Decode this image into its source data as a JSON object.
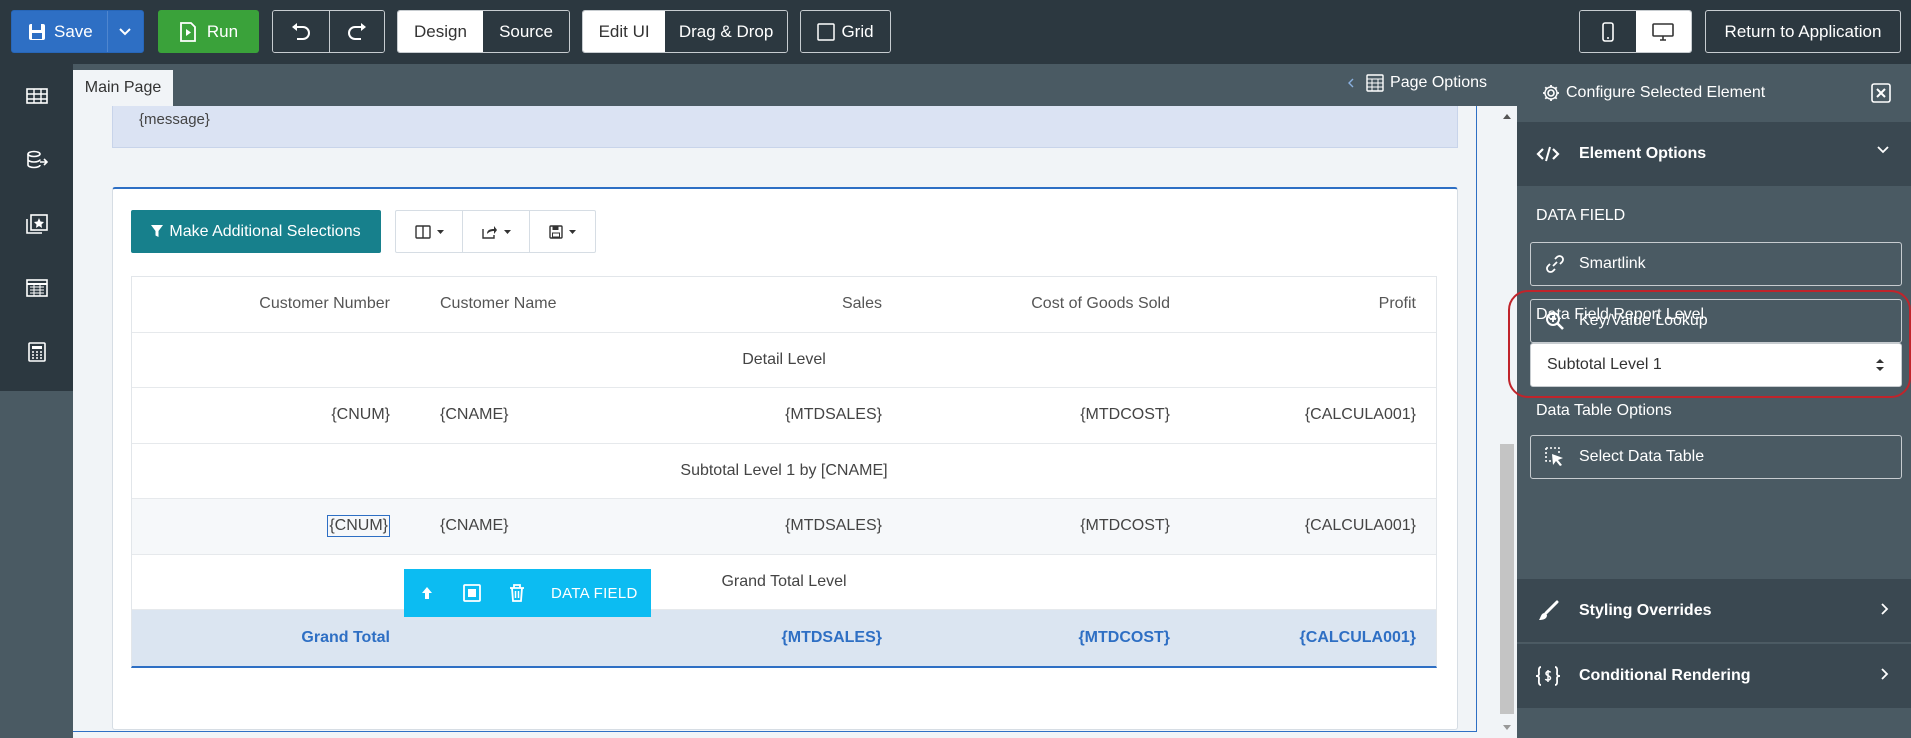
{
  "toolbar": {
    "save_label": "Save",
    "run_label": "Run",
    "design_label": "Design",
    "source_label": "Source",
    "edit_ui_label": "Edit UI",
    "drag_drop_label": "Drag & Drop",
    "grid_label": "Grid",
    "return_label": "Return to Application"
  },
  "tabs": {
    "main_page": "Main Page",
    "page_options": "Page Options"
  },
  "canvas": {
    "message": "{message}",
    "make_selections_label": "Make Additional Selections"
  },
  "table": {
    "headers": [
      "Customer Number",
      "Customer Name",
      "Sales",
      "Cost of Goods Sold",
      "Profit"
    ],
    "detail_level": "Detail Level",
    "detail_row": [
      "{CNUM}",
      "{CNAME}",
      "{MTDSALES}",
      "{MTDCOST}",
      "{CALCULA001}"
    ],
    "subtotal_level": "Subtotal Level 1 by [CNAME]",
    "subtotal_row": [
      "{CNUM}",
      "{CNAME}",
      "{MTDSALES}",
      "{MTDCOST}",
      "{CALCULA001}"
    ],
    "grand_total_level": "Grand Total Level",
    "grand_row": [
      "Grand Total",
      "",
      "{MTDSALES}",
      "{MTDCOST}",
      "{CALCULA001}"
    ]
  },
  "data_field_toolbar": {
    "label": "DATA FIELD"
  },
  "panel": {
    "title": "Configure Selected Element",
    "element_options": "Element Options",
    "data_field_heading": "DATA FIELD",
    "smartlink_label": "Smartlink",
    "kv_lookup_label": "Key/Value Lookup",
    "report_level_label": "Data Field Report Level",
    "report_level_value": "Subtotal Level 1",
    "data_table_options_label": "Data Table Options",
    "select_data_table_label": "Select Data Table",
    "styling_overrides": "Styling Overrides",
    "conditional_rendering": "Conditional Rendering"
  },
  "colors": {
    "topbar": "#2c3840",
    "save": "#2e6fc4",
    "run": "#3aa23a",
    "teal_button": "#17808c",
    "data_field_toolbar": "#0cbcf2",
    "highlight_ring": "#c0242b"
  }
}
